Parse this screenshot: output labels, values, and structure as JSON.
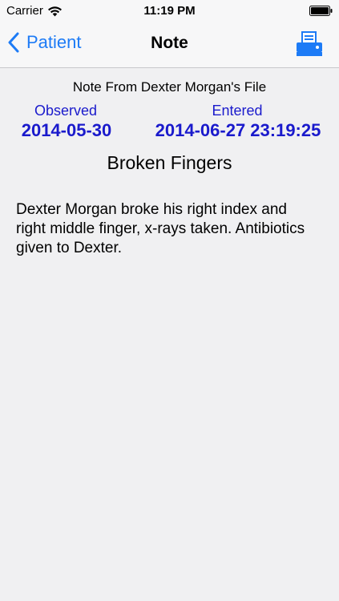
{
  "status_bar": {
    "carrier": "Carrier",
    "time": "11:19 PM"
  },
  "nav": {
    "back_label": "Patient",
    "title": "Note"
  },
  "note": {
    "file_title": "Note From Dexter Morgan's File",
    "observed_label": "Observed",
    "observed_value": "2014-05-30",
    "entered_label": "Entered",
    "entered_value": "2014-06-27 23:19:25",
    "title": "Broken Fingers",
    "body": "Dexter Morgan broke his right index and right middle finger, x-rays taken. Antibiotics given to Dexter."
  },
  "colors": {
    "accent": "#1d7bf6",
    "date_text": "#1a1acc",
    "background": "#f0f0f2"
  },
  "icons": [
    "wifi-icon",
    "battery-icon",
    "chevron-left-icon",
    "print-icon"
  ]
}
